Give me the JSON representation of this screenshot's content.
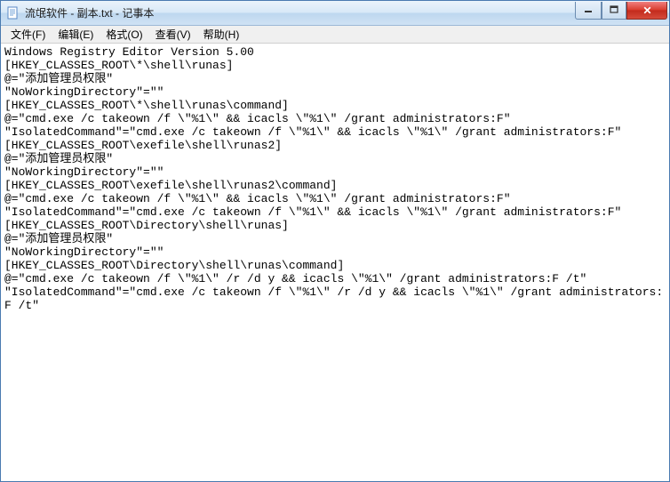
{
  "window": {
    "title": "流氓软件 - 副本.txt - 记事本"
  },
  "menubar": {
    "file": "文件(F)",
    "edit": "编辑(E)",
    "format": "格式(O)",
    "view": "查看(V)",
    "help": "帮助(H)"
  },
  "document": {
    "text": "Windows Registry Editor Version 5.00\n[HKEY_CLASSES_ROOT\\*\\shell\\runas]\n@=\"添加管理员权限\"\n\"NoWorkingDirectory\"=\"\"\n[HKEY_CLASSES_ROOT\\*\\shell\\runas\\command]\n@=\"cmd.exe /c takeown /f \\\"%1\\\" && icacls \\\"%1\\\" /grant administrators:F\"\n\"IsolatedCommand\"=\"cmd.exe /c takeown /f \\\"%1\\\" && icacls \\\"%1\\\" /grant administrators:F\"\n[HKEY_CLASSES_ROOT\\exefile\\shell\\runas2]\n@=\"添加管理员权限\"\n\"NoWorkingDirectory\"=\"\"\n[HKEY_CLASSES_ROOT\\exefile\\shell\\runas2\\command]\n@=\"cmd.exe /c takeown /f \\\"%1\\\" && icacls \\\"%1\\\" /grant administrators:F\"\n\"IsolatedCommand\"=\"cmd.exe /c takeown /f \\\"%1\\\" && icacls \\\"%1\\\" /grant administrators:F\"\n[HKEY_CLASSES_ROOT\\Directory\\shell\\runas]\n@=\"添加管理员权限\"\n\"NoWorkingDirectory\"=\"\"\n[HKEY_CLASSES_ROOT\\Directory\\shell\\runas\\command]\n@=\"cmd.exe /c takeown /f \\\"%1\\\" /r /d y && icacls \\\"%1\\\" /grant administrators:F /t\"\n\"IsolatedCommand\"=\"cmd.exe /c takeown /f \\\"%1\\\" /r /d y && icacls \\\"%1\\\" /grant administrators:F /t\""
  }
}
